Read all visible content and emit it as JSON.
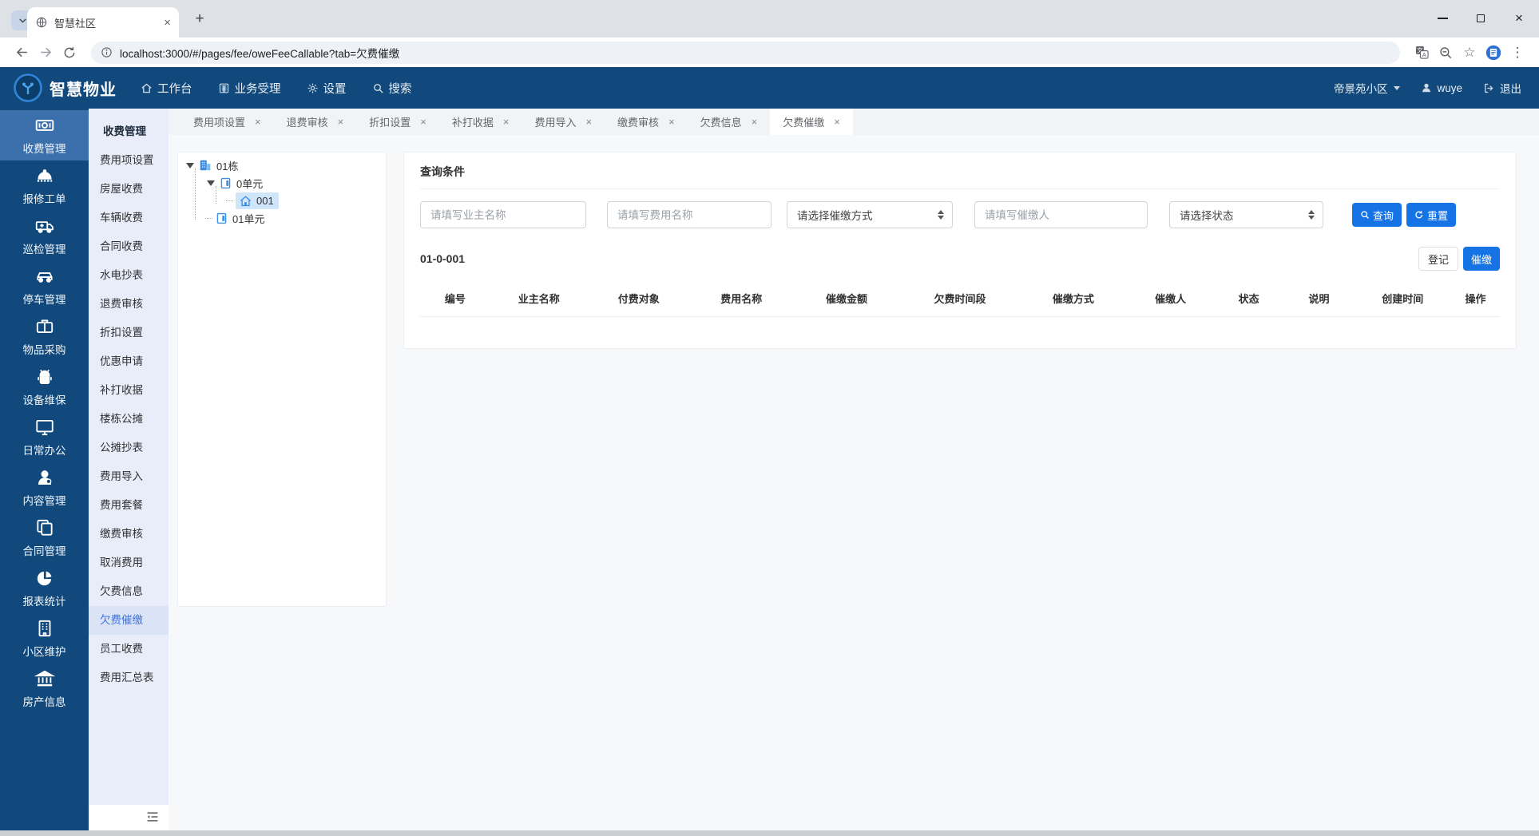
{
  "browser": {
    "tab_title": "智慧社区",
    "url": "localhost:3000/#/pages/fee/oweFeeCallable?tab=欠费催缴",
    "new_tab_label": "+"
  },
  "navbar": {
    "brand": "智慧物业",
    "menu": [
      {
        "label": "工作台",
        "icon": "home-icon"
      },
      {
        "label": "业务受理",
        "icon": "calculator-icon"
      },
      {
        "label": "设置",
        "icon": "gear-icon"
      },
      {
        "label": "搜索",
        "icon": "search-icon"
      }
    ],
    "community": "帝景苑小区",
    "user": "wuye",
    "logout_label": "退出"
  },
  "sidebar": {
    "items": [
      {
        "label": "收费管理",
        "icon": "money-icon",
        "active": true
      },
      {
        "label": "报修工单",
        "icon": "bell-icon"
      },
      {
        "label": "巡检管理",
        "icon": "ambulance-icon"
      },
      {
        "label": "停车管理",
        "icon": "car-icon"
      },
      {
        "label": "物品采购",
        "icon": "briefcase-icon"
      },
      {
        "label": "设备维保",
        "icon": "android-icon"
      },
      {
        "label": "日常办公",
        "icon": "monitor-icon"
      },
      {
        "label": "内容管理",
        "icon": "user-icon"
      },
      {
        "label": "合同管理",
        "icon": "copy-icon"
      },
      {
        "label": "报表统计",
        "icon": "pie-chart-icon"
      },
      {
        "label": "小区维护",
        "icon": "building-icon"
      },
      {
        "label": "房产信息",
        "icon": "bank-icon"
      }
    ]
  },
  "submenu": {
    "title": "收费管理",
    "items": [
      "费用项设置",
      "房屋收费",
      "车辆收费",
      "合同收费",
      "水电抄表",
      "退费审核",
      "折扣设置",
      "优惠申请",
      "补打收据",
      "楼栋公摊",
      "公摊抄表",
      "费用导入",
      "费用套餐",
      "缴费审核",
      "取消费用",
      "欠费信息",
      "欠费催缴",
      "员工收费",
      "费用汇总表"
    ],
    "active_item": "欠费催缴"
  },
  "tabs": {
    "items": [
      "费用项设置",
      "退费审核",
      "折扣设置",
      "补打收据",
      "费用导入",
      "缴费审核",
      "欠费信息",
      "欠费催缴"
    ],
    "active_tab": "欠费催缴"
  },
  "tree": {
    "nodes": [
      {
        "label": "01栋",
        "icon": "building-node-icon",
        "level": 0
      },
      {
        "label": "0单元",
        "icon": "unit-node-icon",
        "level": 1
      },
      {
        "label": "001",
        "icon": "house-node-icon",
        "level": 2,
        "selected": true
      },
      {
        "label": "01单元",
        "icon": "unit-node-icon",
        "level": 1
      }
    ]
  },
  "query": {
    "title": "查询条件",
    "owner_placeholder": "请填写业主名称",
    "fee_placeholder": "请填写费用名称",
    "method_selected": "请选择催缴方式",
    "person_placeholder": "请填写催缴人",
    "state_selected": "请选择状态",
    "search_label": "查询",
    "reset_label": "重置"
  },
  "section": {
    "title": "01-0-001",
    "register_label": "登记",
    "urge_label": "催缴"
  },
  "table": {
    "headers": [
      "编号",
      "业主名称",
      "付费对象",
      "费用名称",
      "催缴金额",
      "欠费时间段",
      "催缴方式",
      "催缴人",
      "状态",
      "说明",
      "创建时间",
      "操作"
    ]
  },
  "colors": {
    "navbar_bg": "#11497c",
    "sidebar_selected_bg": "#3b70ac",
    "submenu_bg": "#e9edf9",
    "active_link": "#3f73de",
    "primary_button": "#1673e6",
    "tree_selected_bg": "#cfe5f9",
    "tree_icon_blue": "#3a8ee6",
    "content_bg": "#f7f8fa"
  }
}
